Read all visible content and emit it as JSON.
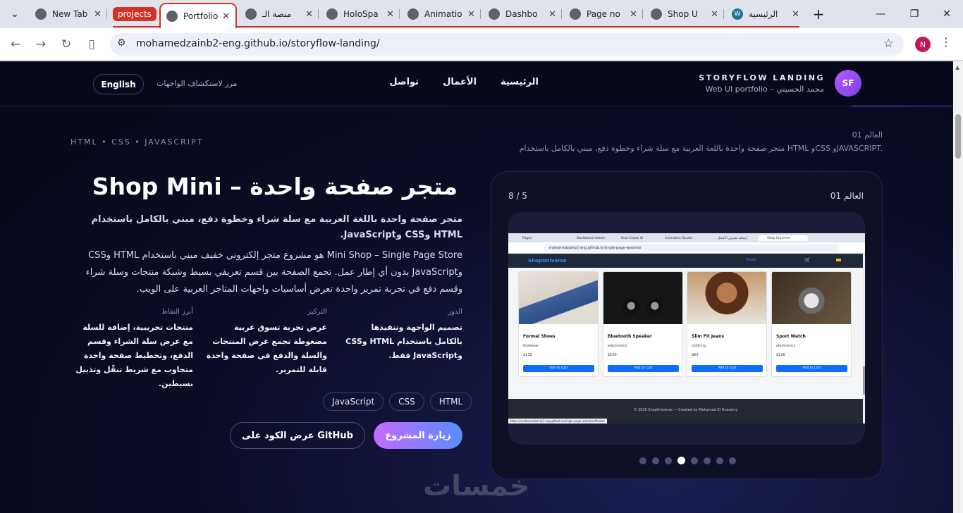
{
  "browser": {
    "tabs": [
      {
        "title": "New Tab"
      },
      {
        "title": "Portfolio"
      },
      {
        "title": "منصة الـ"
      },
      {
        "title": "HoloSpa"
      },
      {
        "title": "Animatio"
      },
      {
        "title": "Dashbo"
      },
      {
        "title": "Page no"
      },
      {
        "title": "Shop U"
      },
      {
        "title": "الرئيسية"
      }
    ],
    "group_label": "projects",
    "url": "mohamedzainb2-eng.github.io/storyflow-landing/",
    "profile_initial": "N"
  },
  "header": {
    "avatar": "SF",
    "brand": "STORYFLOW LANDING",
    "brand_sub": "Web UI portfolio – محمد الحسيني",
    "nav": [
      "الرئيسية",
      "الأعمال",
      "تواصل"
    ],
    "hint": "مرر لاستكشاف الواجهات",
    "lang_button": "English"
  },
  "hero": {
    "tech": "HTML • CSS • JAVASCRIPT",
    "world_label": "العالم 01",
    "world_desc": "متجر صفحة واحدة باللغة العربية مع سلة شراء وخطوة دفع، مبني بالكامل باستخدام HTML وCSS وJAVASCRIPT.",
    "title": "Shop Mini – متجر صفحة واحدة",
    "lead": "متجر صفحة واحدة باللغة العربية مع سلة شراء وخطوة دفع، مبني بالكامل باستخدام HTML وCSS وJavaScript.",
    "body": "Mini Shop – Single Page Store هو مشروع متجر إلكتروني خفيف مبني باستخدام HTML وCSS وJavaScript بدون أي إطار عمل. تجمع الصفحة بين قسم تعريفي بسيط وشبكة منتجات وسلة شراء وقسم دفع في تجربة تمرير واحدة تعرض أساسيات واجهات المتاجر العربية على الويب.",
    "columns": [
      {
        "heading": "الدور",
        "text": "تصميم الواجهة وتنفيذها بالكامل باستخدام HTML وCSS وJavaScript فقط."
      },
      {
        "heading": "التركيز",
        "text": "عرض تجربة تسوق عربية مضغوطة تجمع عرض المنتجات والسلة والدفع في صفحة واحدة قابلة للتمرير."
      },
      {
        "heading": "أبرز النقاط",
        "text": "منتجات تجريبية، إضافة للسلة مع عرض سلة الشراء وقسم الدفع، وتخطيط صفحة واحدة متجاوب مع شريط تنقّل وتذييل بسيطين."
      }
    ],
    "chips": [
      "HTML",
      "CSS",
      "JavaScript"
    ],
    "primary_button": "زيارة المشروع",
    "secondary_button": "عرض الكود على GitHub"
  },
  "card": {
    "title": "العالم 01",
    "counter": "8 / 5",
    "dots_total": 8,
    "dots_active": 4
  },
  "preview": {
    "tabs": [
      "Pages",
      "Dashboard Admin",
      "Real Estate UI",
      "Animation Studio",
      "إضافة مجرس الأعمال",
      "Shop Universe"
    ],
    "url": "mohamedzainb2-eng.github.io/single-page-website/",
    "brand": "ShopUniverse",
    "nav_home": "Home",
    "products": [
      {
        "name": "Formal Shoes",
        "category": "footwear",
        "price": "$110",
        "button": "Add to Cart"
      },
      {
        "name": "Bluetooth Speaker",
        "category": "electronics",
        "price": "$150",
        "button": "Add to Cart"
      },
      {
        "name": "Slim Fit Jeans",
        "category": "clothing",
        "price": "$60",
        "button": "Add to Cart"
      },
      {
        "name": "Sport Watch",
        "category": "electronics",
        "price": "$220",
        "button": "Add to Cart"
      }
    ],
    "footer": "© 2025 ShopUniverse — Created by Mohamed El Husseiny",
    "status": "https://mohamedzainb2-eng.github.io/single-page-website/#footer"
  },
  "watermark": "خمسات"
}
